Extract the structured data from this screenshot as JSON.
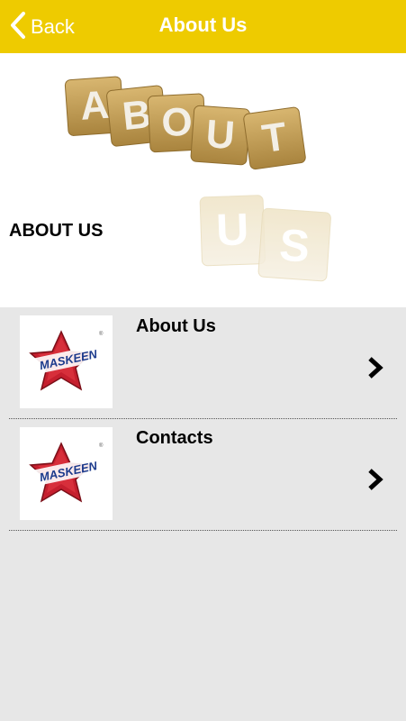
{
  "header": {
    "back_label": "Back",
    "title": "About Us",
    "bg_color": "#eecb00"
  },
  "banner": {
    "heading": "ABOUT US",
    "tiles_top": [
      "A",
      "B",
      "O",
      "U",
      "T"
    ],
    "tiles_bottom": [
      "U",
      "S"
    ]
  },
  "list": {
    "items": [
      {
        "title": "About Us",
        "logo_text": "MASKEEN",
        "icon": "chevron-right-icon"
      },
      {
        "title": "Contacts",
        "logo_text": "MASKEEN",
        "icon": "chevron-right-icon"
      }
    ]
  }
}
